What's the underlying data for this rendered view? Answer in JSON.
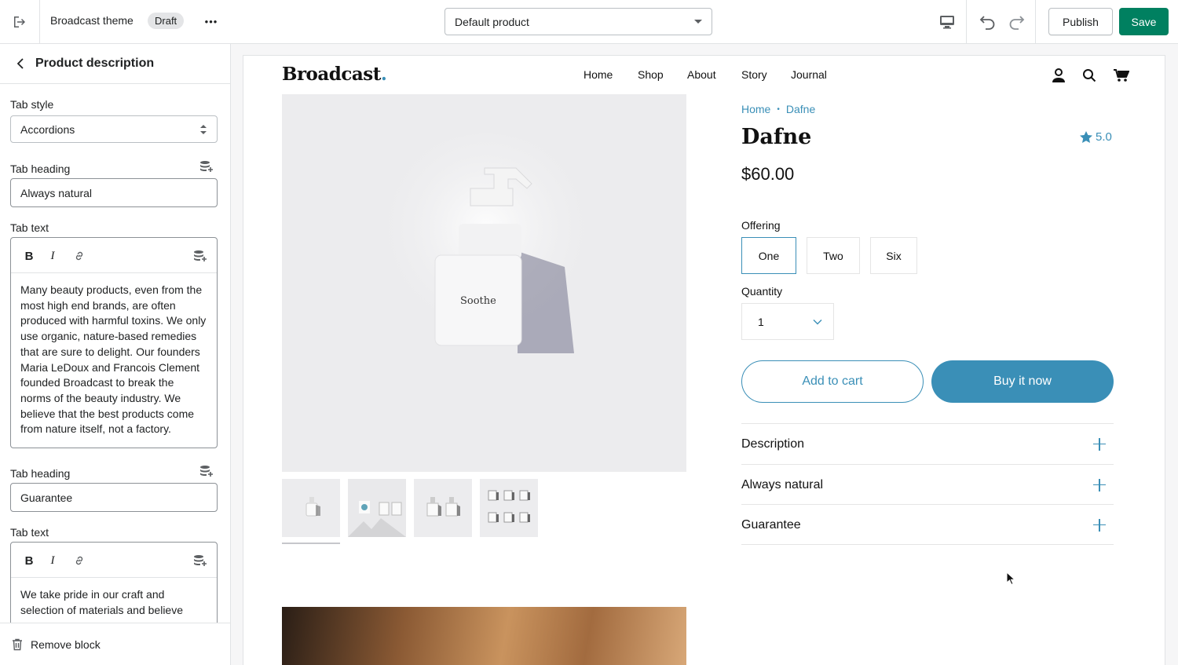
{
  "topbar": {
    "theme_name": "Broadcast theme",
    "status_badge": "Draft",
    "more_label": "•••",
    "product_select_value": "Default product",
    "publish_label": "Publish",
    "save_label": "Save"
  },
  "sidebar": {
    "title": "Product description",
    "tab_style_label": "Tab style",
    "tab_style_value": "Accordions",
    "blocks": [
      {
        "heading_label": "Tab heading",
        "heading_value": "Always natural",
        "text_label": "Tab text",
        "text_value": "Many beauty products, even from the most high end brands, are often produced with harmful toxins. We only use organic, nature-based remedies that are sure to delight. Our founders Maria LeDoux and Francois Clement founded Broadcast to break the norms of the beauty industry. We believe that the best products come from nature itself, not a factory."
      },
      {
        "heading_label": "Tab heading",
        "heading_value": "Guarantee",
        "text_label": "Tab text",
        "text_value": "We take pride in our craft and selection of materials and believe"
      }
    ],
    "rte_bold": "B",
    "rte_italic": "I",
    "remove_label": "Remove block"
  },
  "store": {
    "logo": "Broadcast",
    "logo_dot": ".",
    "nav": [
      "Home",
      "Shop",
      "About",
      "Story",
      "Journal"
    ],
    "product_label_text": "Soothe",
    "breadcrumb": [
      "Home",
      "Dafne"
    ],
    "breadcrumb_sep": "•",
    "product_title": "Dafne",
    "rating": "5.0",
    "price": "$60.00",
    "offering_label": "Offering",
    "offerings": [
      "One",
      "Two",
      "Six"
    ],
    "selected_offering": "One",
    "quantity_label": "Quantity",
    "quantity_value": "1",
    "add_to_cart": "Add to cart",
    "buy_now": "Buy it now",
    "accordions": [
      "Description",
      "Always natural",
      "Guarantee"
    ]
  },
  "colors": {
    "accent": "#3a8fb7",
    "save_green": "#008060",
    "border": "#e1e3e5"
  }
}
